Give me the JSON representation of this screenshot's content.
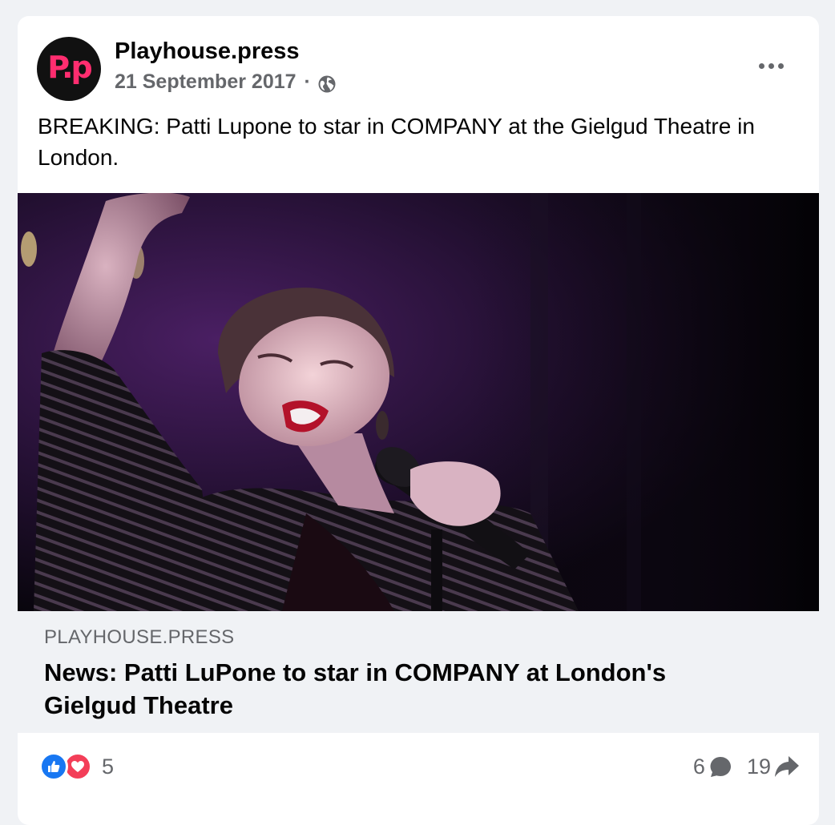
{
  "post": {
    "page_name": "Playhouse.press",
    "avatar_text": "P.p",
    "date": "21 September 2017",
    "separator": "·",
    "audience_icon": "globe-icon",
    "menu_icon": "more-options-icon",
    "text": "BREAKING: Patti Lupone to star in COMPANY at the Gielgud Theatre in London."
  },
  "link_preview": {
    "domain": "PLAYHOUSE.PRESS",
    "headline": "News: Patti LuPone to star in COMPANY at London's Gielgud Theatre"
  },
  "footer": {
    "reaction_icons": [
      "like-icon",
      "love-icon"
    ],
    "reaction_count": "5",
    "comment_count": "6",
    "share_count": "19"
  },
  "colors": {
    "brand_pink": "#ff2d6f",
    "like_blue": "#1877f2",
    "love_red": "#f33e58",
    "secondary_text": "#65676b"
  }
}
